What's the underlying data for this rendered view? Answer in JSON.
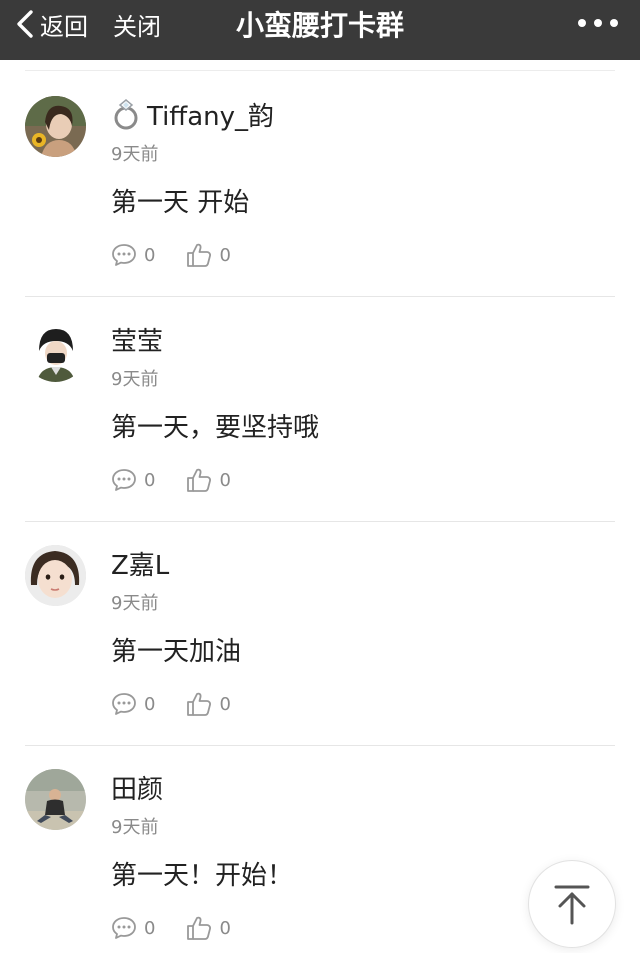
{
  "navbar": {
    "back_label": "返回",
    "close_label": "关闭",
    "title": "小蛮腰打卡群"
  },
  "posts": [
    {
      "username": "Tiffany_韵",
      "has_ring_icon": true,
      "time": "9天前",
      "content": "第一天 开始",
      "comments": "0",
      "likes": "0"
    },
    {
      "username": "莹莹",
      "has_ring_icon": false,
      "time": "9天前",
      "content": "第一天，要坚持哦",
      "comments": "0",
      "likes": "0"
    },
    {
      "username": "Z嘉L",
      "has_ring_icon": false,
      "time": "9天前",
      "content": "第一天加油",
      "comments": "0",
      "likes": "0"
    },
    {
      "username": "田颜",
      "has_ring_icon": false,
      "time": "9天前",
      "content": "第一天！开始！",
      "comments": "0",
      "likes": "0"
    }
  ],
  "icons": {
    "back": "chevron-left-icon",
    "more": "more-dots-icon",
    "comment": "comment-bubble-icon",
    "like": "thumbs-up-icon",
    "back_to_top": "arrow-up-icon"
  },
  "colors": {
    "navbar_bg": "#3a3a3a",
    "muted_text": "#8a8a8a"
  }
}
